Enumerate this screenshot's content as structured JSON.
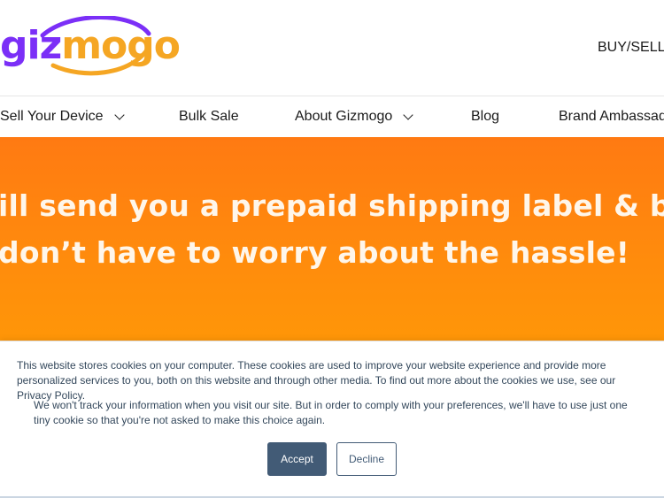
{
  "header": {
    "logo_text_part1": "giz",
    "logo_text_part2": "mogo",
    "buy_sell": "BUY/SELL"
  },
  "nav": {
    "items": [
      {
        "label": "Sell Your Device",
        "dropdown": true
      },
      {
        "label": "Bulk Sale",
        "dropdown": false
      },
      {
        "label": "About Gizmogo",
        "dropdown": true
      },
      {
        "label": "Blog",
        "dropdown": false
      },
      {
        "label": "Brand Ambassado",
        "dropdown": false
      }
    ]
  },
  "hero": {
    "line1": "ill send you a prepaid shipping label & box so",
    "line2": "don’t have to worry about the hassle!"
  },
  "cookie_banner": {
    "paragraph1": "This website stores cookies on your computer. These cookies are used to improve your website experience and provide more personalized services to you, both on this website and through other media. To find out more about the cookies we use, see our Privacy Policy.",
    "paragraph2": "We won't track your information when you visit our site. But in order to comply with your preferences, we'll have to use just one tiny cookie so that you're not asked to make this choice again.",
    "accept_label": "Accept",
    "decline_label": "Decline"
  },
  "colors": {
    "brand_purple": "#7b2ff7",
    "brand_orange": "#f5a623",
    "hero_orange": "#ff8a0d",
    "button_navy": "#425b76"
  }
}
